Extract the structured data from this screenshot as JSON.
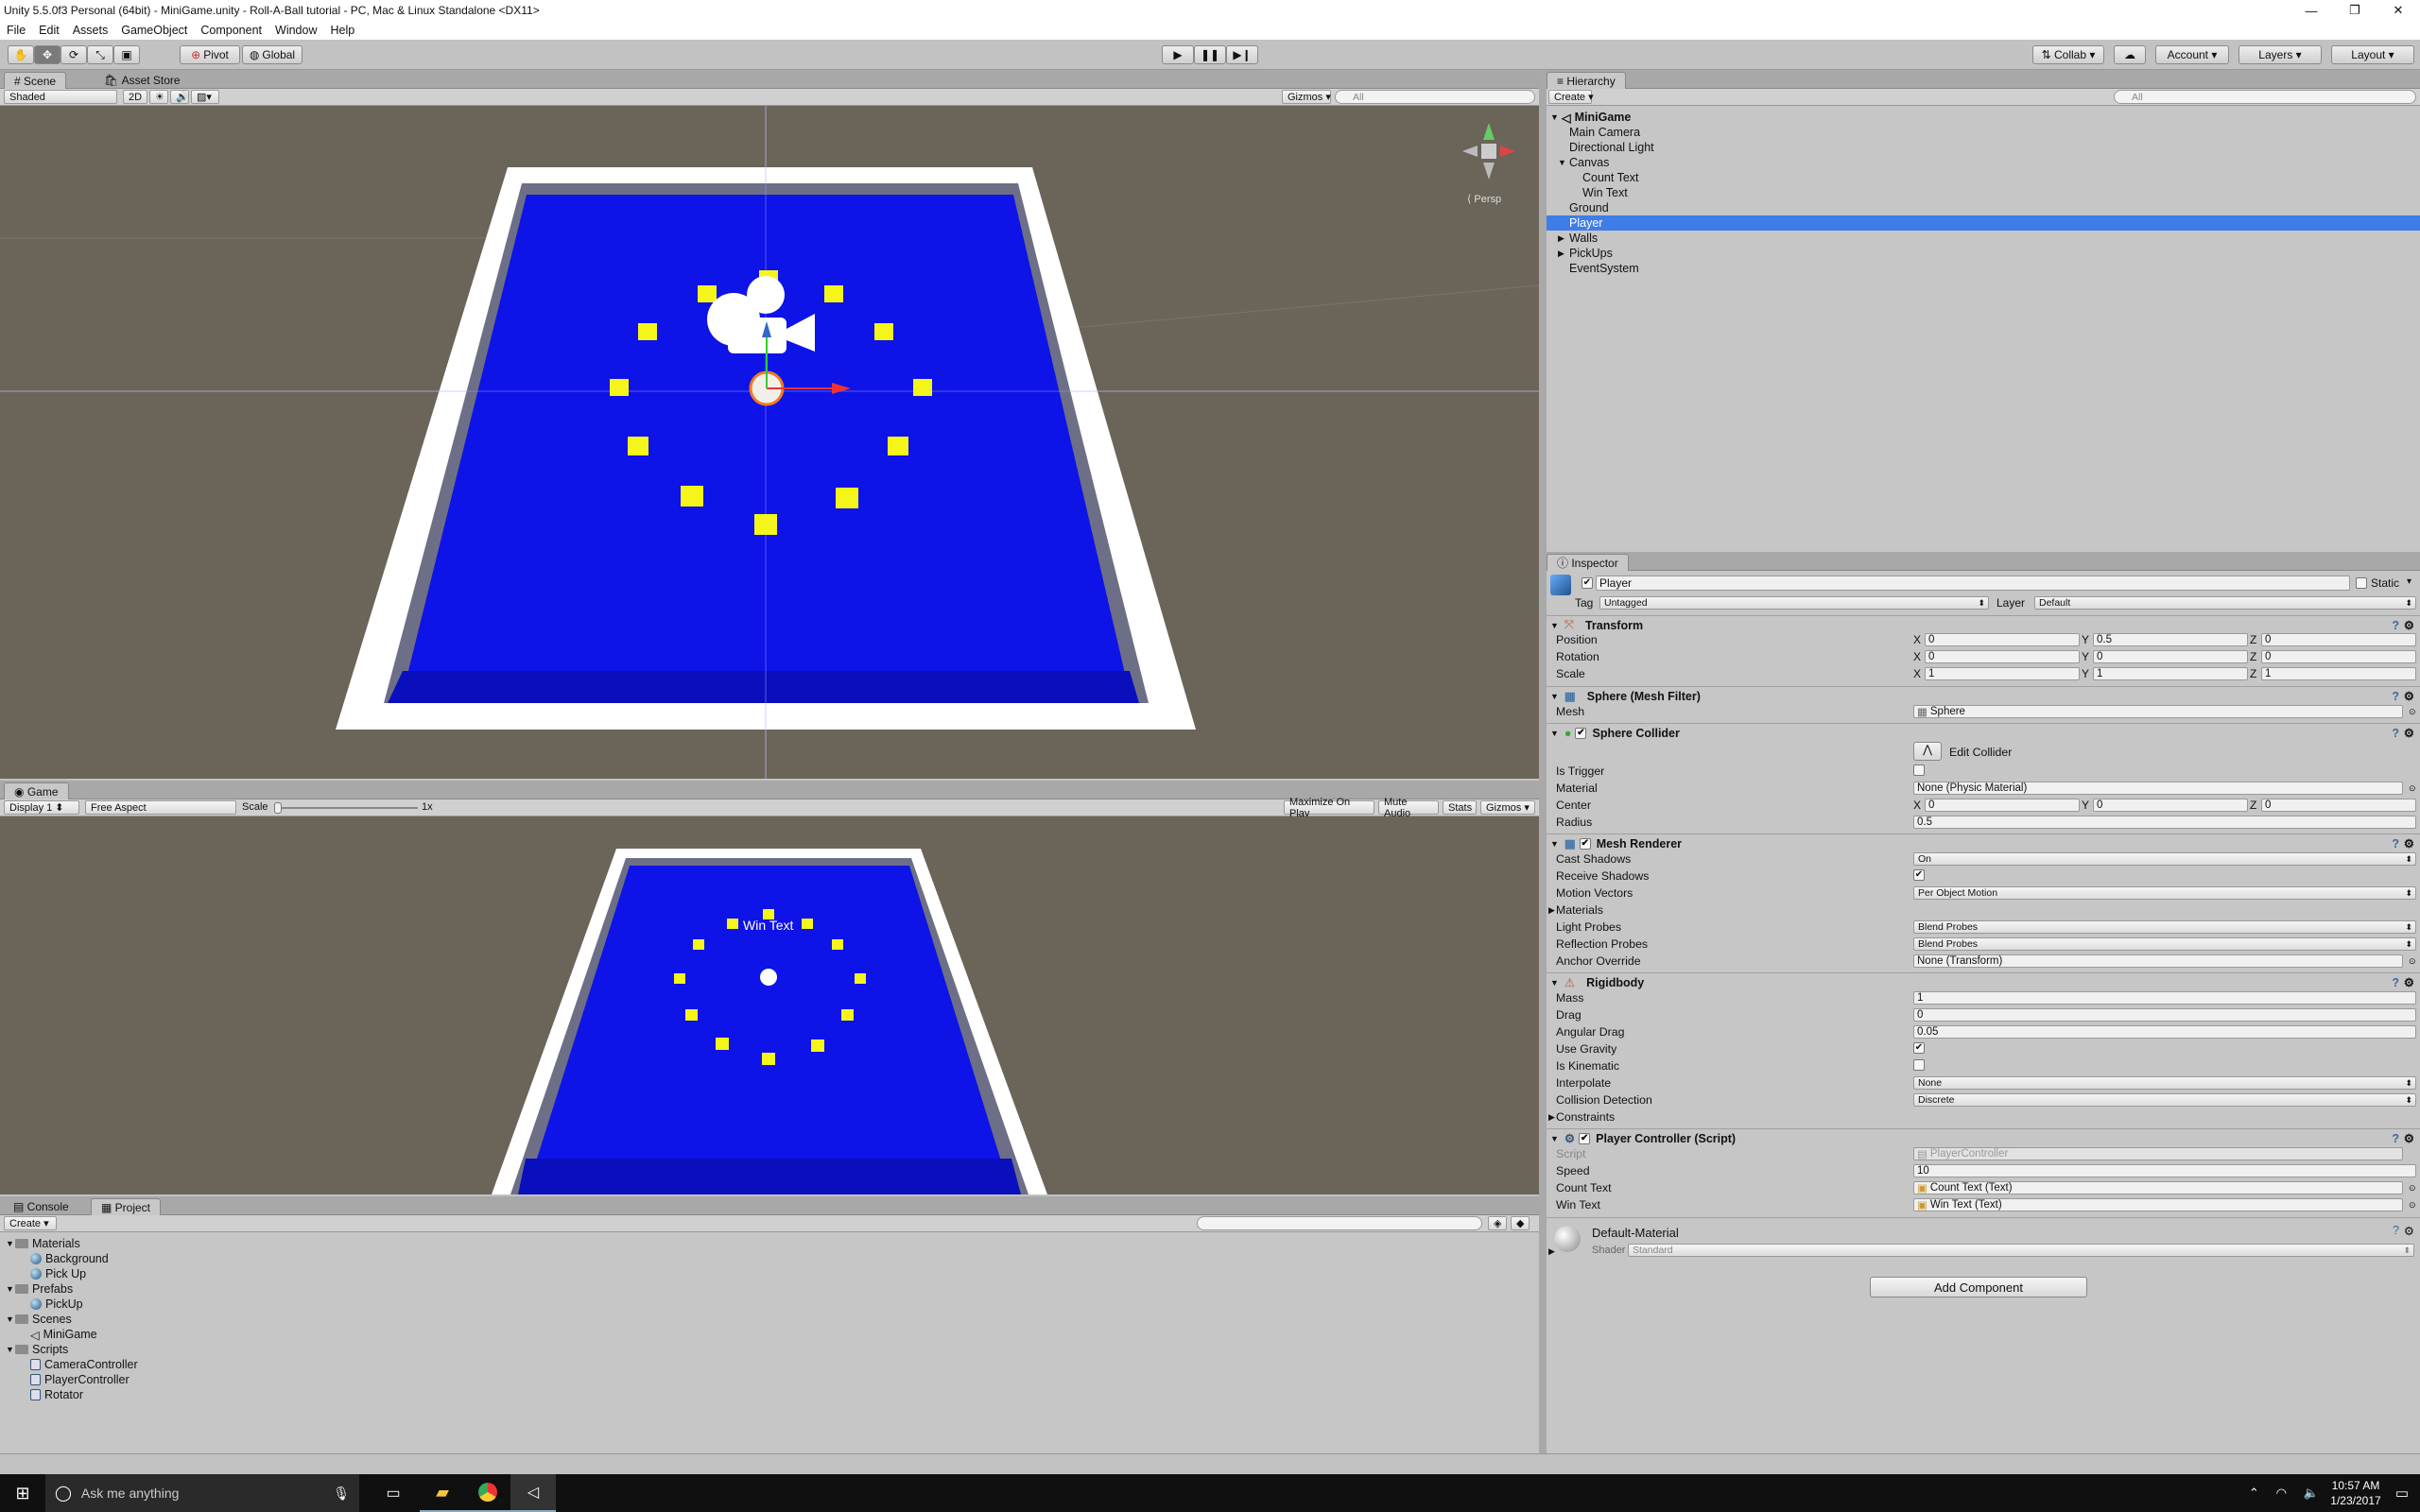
{
  "window": {
    "title": "Unity 5.5.0f3 Personal (64bit) - MiniGame.unity - Roll-A-Ball tutorial - PC, Mac & Linux Standalone <DX11>"
  },
  "menu": [
    "File",
    "Edit",
    "Assets",
    "GameObject",
    "Component",
    "Window",
    "Help"
  ],
  "toolbar": {
    "pivot": "Pivot",
    "global": "Global",
    "collab": "Collab",
    "account": "Account",
    "layers": "Layers",
    "layout": "Layout"
  },
  "scene": {
    "tabs": [
      "Scene",
      "Asset Store"
    ],
    "shading": "Shaded",
    "mode2d": "2D",
    "gizmos": "Gizmos",
    "search_placeholder": "All",
    "persp": "Persp"
  },
  "game": {
    "tab": "Game",
    "display": "Display 1",
    "aspect": "Free Aspect",
    "scale_label": "Scale",
    "scale_value": "1x",
    "buttons": [
      "Maximize On Play",
      "Mute Audio",
      "Stats",
      "Gizmos"
    ],
    "win_text": "Win Text"
  },
  "hierarchy": {
    "tab": "Hierarchy",
    "create": "Create",
    "search_placeholder": "All",
    "scene_name": "MiniGame",
    "items": [
      {
        "label": "Main Camera",
        "indent": 1,
        "arrow": ""
      },
      {
        "label": "Directional Light",
        "indent": 1,
        "arrow": ""
      },
      {
        "label": "Canvas",
        "indent": 1,
        "arrow": "▼"
      },
      {
        "label": "Count Text",
        "indent": 2,
        "arrow": ""
      },
      {
        "label": "Win Text",
        "indent": 2,
        "arrow": ""
      },
      {
        "label": "Ground",
        "indent": 1,
        "arrow": ""
      },
      {
        "label": "Player",
        "indent": 1,
        "arrow": "",
        "selected": true
      },
      {
        "label": "Walls",
        "indent": 1,
        "arrow": "▶"
      },
      {
        "label": "PickUps",
        "indent": 1,
        "arrow": "▶"
      },
      {
        "label": "EventSystem",
        "indent": 1,
        "arrow": ""
      }
    ]
  },
  "inspector": {
    "tab": "Inspector",
    "object_name": "Player",
    "static_label": "Static",
    "tag_label": "Tag",
    "tag_value": "Untagged",
    "layer_label": "Layer",
    "layer_value": "Default",
    "transform": {
      "title": "Transform",
      "position_label": "Position",
      "position": [
        "0",
        "0.5",
        "0"
      ],
      "rotation_label": "Rotation",
      "rotation": [
        "0",
        "0",
        "0"
      ],
      "scale_label": "Scale",
      "scale": [
        "1",
        "1",
        "1"
      ]
    },
    "mesh_filter": {
      "title": "Sphere (Mesh Filter)",
      "mesh_label": "Mesh",
      "mesh_value": "Sphere"
    },
    "sphere_collider": {
      "title": "Sphere Collider",
      "edit_collider": "Edit Collider",
      "is_trigger_label": "Is Trigger",
      "material_label": "Material",
      "material_value": "None (Physic Material)",
      "center_label": "Center",
      "center": [
        "0",
        "0",
        "0"
      ],
      "radius_label": "Radius",
      "radius_value": "0.5"
    },
    "mesh_renderer": {
      "title": "Mesh Renderer",
      "cast_shadows_label": "Cast Shadows",
      "cast_shadows_value": "On",
      "receive_shadows_label": "Receive Shadows",
      "motion_vectors_label": "Motion Vectors",
      "motion_vectors_value": "Per Object Motion",
      "materials_label": "Materials",
      "light_probes_label": "Light Probes",
      "light_probes_value": "Blend Probes",
      "reflection_probes_label": "Reflection Probes",
      "reflection_probes_value": "Blend Probes",
      "anchor_override_label": "Anchor Override",
      "anchor_override_value": "None (Transform)"
    },
    "rigidbody": {
      "title": "Rigidbody",
      "mass_label": "Mass",
      "mass_value": "1",
      "drag_label": "Drag",
      "drag_value": "0",
      "angular_drag_label": "Angular Drag",
      "angular_drag_value": "0.05",
      "use_gravity_label": "Use Gravity",
      "is_kinematic_label": "Is Kinematic",
      "interpolate_label": "Interpolate",
      "interpolate_value": "None",
      "collision_detection_label": "Collision Detection",
      "collision_detection_value": "Discrete",
      "constraints_label": "Constraints"
    },
    "player_controller": {
      "title": "Player Controller (Script)",
      "script_label": "Script",
      "script_value": "PlayerController",
      "speed_label": "Speed",
      "speed_value": "10",
      "count_text_label": "Count Text",
      "count_text_value": "Count Text (Text)",
      "win_text_label": "Win Text",
      "win_text_value": "Win Text (Text)"
    },
    "material": {
      "name": "Default-Material",
      "shader_label": "Shader",
      "shader_value": "Standard"
    },
    "add_component": "Add Component"
  },
  "project": {
    "tabs": [
      "Console",
      "Project"
    ],
    "create": "Create",
    "tree": [
      {
        "label": "Materials",
        "type": "folder"
      },
      {
        "label": "Background",
        "type": "material"
      },
      {
        "label": "Pick Up",
        "type": "material"
      },
      {
        "label": "Prefabs",
        "type": "folder"
      },
      {
        "label": "PickUp",
        "type": "material"
      },
      {
        "label": "Scenes",
        "type": "folder"
      },
      {
        "label": "MiniGame",
        "type": "scene"
      },
      {
        "label": "Scripts",
        "type": "folder"
      },
      {
        "label": "CameraController",
        "type": "script"
      },
      {
        "label": "PlayerController",
        "type": "script"
      },
      {
        "label": "Rotator",
        "type": "script"
      }
    ]
  },
  "taskbar": {
    "search_placeholder": "Ask me anything",
    "time": "10:57 AM",
    "date": "1/23/2017"
  }
}
